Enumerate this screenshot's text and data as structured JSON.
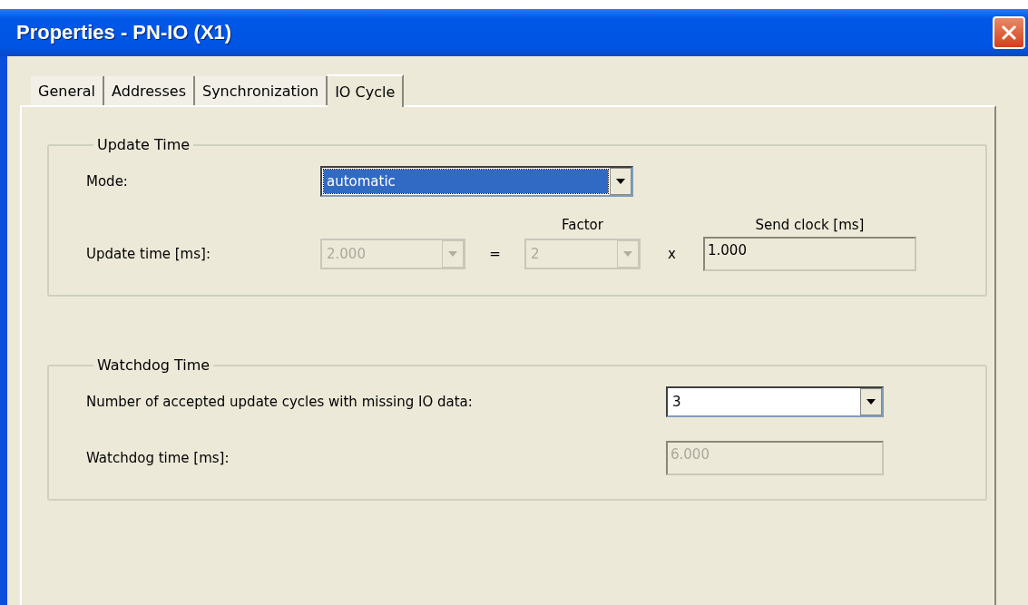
{
  "window": {
    "title": "Properties - PN-IO (X1)"
  },
  "tabs": [
    {
      "label": "General",
      "selected": false
    },
    {
      "label": "Addresses",
      "selected": false
    },
    {
      "label": "Synchronization",
      "selected": false
    },
    {
      "label": "IO Cycle",
      "selected": true
    }
  ],
  "update_time": {
    "title": "Update Time",
    "mode": {
      "label": "Mode:",
      "value": "automatic",
      "highlighted": true,
      "disabled": false
    },
    "factor_header": "Factor",
    "send_clock_header": "Send clock [ms]",
    "update_time": {
      "label": "Update time [ms]:",
      "value": "2.000",
      "disabled": true
    },
    "equals": "=",
    "factor": {
      "value": "2",
      "disabled": true
    },
    "times": "x",
    "send_clock": {
      "value": "1.000",
      "readonly": true
    }
  },
  "watchdog": {
    "title": "Watchdog Time",
    "cycles": {
      "label": "Number of accepted update cycles with missing IO data:",
      "value": "3",
      "disabled": false
    },
    "watchdog_time": {
      "label": "Watchdog time [ms]:",
      "value": "6.000",
      "disabled": true
    }
  }
}
